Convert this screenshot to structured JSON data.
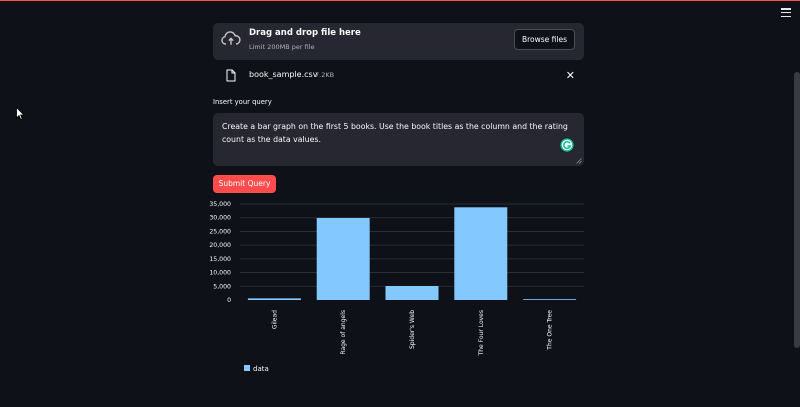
{
  "uploader": {
    "title": "Drag and drop file here",
    "limit": "Limit 200MB per file",
    "browse_label": "Browse files"
  },
  "file": {
    "name": "book_sample.csv",
    "size": "7.2KB",
    "close_glyph": "✕"
  },
  "query": {
    "label": "Insert your query",
    "value": "Create a bar graph on the first 5 books. Use the book titles as the column and the rating count as the data values."
  },
  "submit": {
    "label": "Submit Query"
  },
  "colors": {
    "accent": "#ff4b4b",
    "bar": "#83c9ff",
    "background": "#0e1117",
    "surface": "#262730"
  },
  "chart_data": {
    "type": "bar",
    "categories": [
      "Gilead",
      "Rage of angels",
      "Spider's Web",
      "The Four Loves",
      "The One Tree"
    ],
    "series": [
      {
        "name": "data",
        "values": [
          600,
          29900,
          5100,
          33800,
          300
        ]
      }
    ],
    "y_ticks": [
      0,
      5000,
      10000,
      15000,
      20000,
      25000,
      30000,
      35000
    ],
    "y_tick_labels": [
      "0",
      "5,000",
      "10,000",
      "15,000",
      "20,000",
      "25,000",
      "30,000",
      "35,000"
    ],
    "ylim": [
      0,
      35000
    ],
    "grid": true,
    "legend_position": "bottom-left"
  }
}
